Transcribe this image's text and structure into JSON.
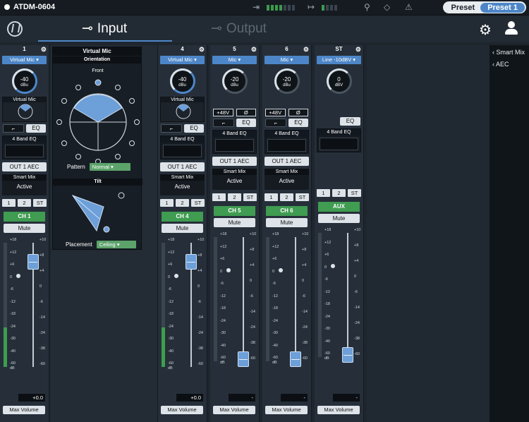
{
  "app": {
    "device_name": "ATDM-0604"
  },
  "top": {
    "preset_label": "Preset",
    "preset_value": "Preset 1"
  },
  "tabs": {
    "input": "Input",
    "output": "Output"
  },
  "right_panel": {
    "smart_mix": "Smart Mix",
    "aec": "AEC"
  },
  "virtual_mic_panel": {
    "title": "Virtual Mic",
    "orientation": "Orientation",
    "front": "Front",
    "pattern_label": "Pattern",
    "pattern_value": "Normal",
    "tilt": "Tilt",
    "placement_label": "Placement",
    "placement_value": "Ceiling"
  },
  "channels": [
    {
      "num": "1",
      "source": "Virtual Mic",
      "gain": "-40",
      "unit": "dBu",
      "name": "CH 1",
      "readout": "+0.0",
      "fader_db": 0
    },
    {
      "num": "4",
      "source": "Virtual Mic",
      "gain": "-40",
      "unit": "dBu",
      "name": "CH 4",
      "readout": "+0.0",
      "fader_db": 0
    },
    {
      "num": "5",
      "source": "Mic",
      "gain": "-20",
      "unit": "dBu",
      "name": "CH 5",
      "readout": "-",
      "fader_db": -60
    },
    {
      "num": "6",
      "source": "Mic",
      "gain": "-20",
      "unit": "dBu",
      "name": "CH 6",
      "readout": "-",
      "fader_db": -60
    },
    {
      "num": "ST",
      "source": "Line -10dBV",
      "gain": "0",
      "unit": "dBV",
      "name": "AUX",
      "readout": "-",
      "fader_db": -60
    }
  ],
  "labels": {
    "virtual_mic": "Virtual Mic",
    "eq": "EQ",
    "four_band": "4 Band EQ",
    "out_aec": "OUT 1 AEC",
    "smart_mix": "Smart Mix",
    "active": "Active",
    "bus1": "1",
    "bus2": "2",
    "busst": "ST",
    "mute": "Mute",
    "max_volume": "Max Volume",
    "phantom": "+48V",
    "phase": "Ø",
    "db": "dB"
  }
}
